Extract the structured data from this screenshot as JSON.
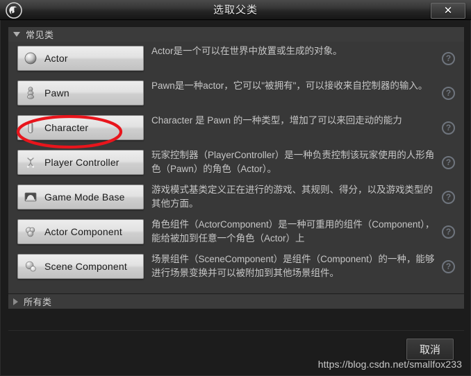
{
  "window": {
    "title": "选取父类",
    "logo_icon": "unreal-engine-logo",
    "close_icon": "close-icon",
    "close_label": "✕"
  },
  "sections": {
    "common": {
      "label": "常见类",
      "expanded": true,
      "toggle_icon": "triangle-down-icon"
    },
    "all": {
      "label": "所有类",
      "expanded": false,
      "toggle_icon": "triangle-right-icon"
    }
  },
  "classes": [
    {
      "name": "Actor",
      "icon": "actor-sphere-icon",
      "description": "Actor是一个可以在世界中放置或生成的对象。",
      "help_icon": "help-question-icon",
      "help_label": "?"
    },
    {
      "name": "Pawn",
      "icon": "pawn-icon",
      "description": "Pawn是一种actor，它可以\"被拥有\"，可以接收来自控制器的输入。",
      "help_icon": "help-question-icon",
      "help_label": "?"
    },
    {
      "name": "Character",
      "icon": "character-capsule-icon",
      "description": "Character 是 Pawn 的一种类型，增加了可以来回走动的能力",
      "help_icon": "help-question-icon",
      "help_label": "?"
    },
    {
      "name": "Player Controller",
      "icon": "player-controller-icon",
      "description": "玩家控制器（PlayerController）是一种负责控制该玩家使用的人形角色（Pawn）的角色（Actor）。",
      "help_icon": "help-question-icon",
      "help_label": "?"
    },
    {
      "name": "Game Mode Base",
      "icon": "game-mode-base-icon",
      "description": "游戏模式基类定义正在进行的游戏、其规则、得分，以及游戏类型的其他方面。",
      "help_icon": "help-question-icon",
      "help_label": "?"
    },
    {
      "name": "Actor Component",
      "icon": "actor-component-icon",
      "description": "角色组件（ActorComponent）是一种可重用的组件（Component），能给被加到任意一个角色（Actor）上",
      "help_icon": "help-question-icon",
      "help_label": "?"
    },
    {
      "name": "Scene Component",
      "icon": "scene-component-icon",
      "description": "场景组件（SceneComponent）是组件（Component）的一种，能够进行场景变换并可以被附加到其他场景组件。",
      "help_icon": "help-question-icon",
      "help_label": "?"
    }
  ],
  "footer": {
    "cancel_label": "取消",
    "watermark": "https://blog.csdn.net/smallfox233"
  },
  "annotation": {
    "type": "ellipse-highlight",
    "target": "Character",
    "color": "#e8151c"
  },
  "colors": {
    "titlebar_top": "#4a4a4a",
    "panel_bg": "#383838",
    "dialog_bg": "#1c1c1c",
    "section_header": "#3b3b3b",
    "button_face": "#e2e2e2",
    "description_text": "#c6c6c6",
    "annotation_red": "#e8151c"
  }
}
